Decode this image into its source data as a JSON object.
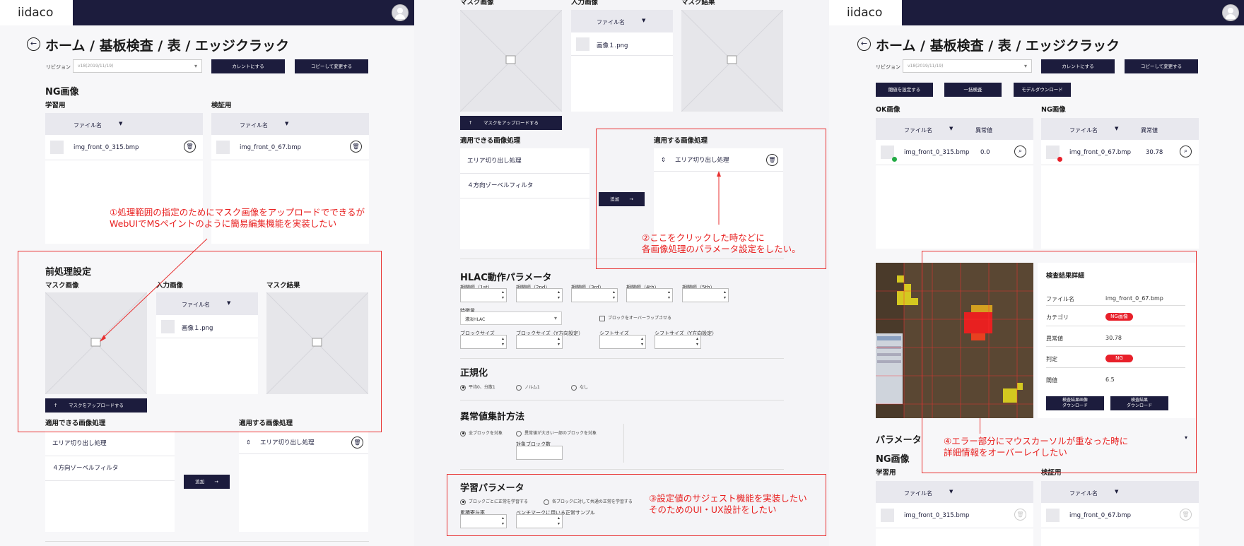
{
  "brand": {
    "name": "iidaco"
  },
  "breadcrumb": "ホーム / 基板検査 / 表 / エッジクラック",
  "revision": {
    "label": "リビジョン",
    "value": "v18(2019/11/19)"
  },
  "buttons": {
    "make_current": "カレントにする",
    "copy_change": "コピーして変更する",
    "set_threshold": "閾値を設定する",
    "batch_inspect": "一括検査",
    "model_download": "モデルダウンロード",
    "upload_mask": "マスクをアップロードする",
    "add": "追加",
    "download_results_images": "検査結果画像\nダウンロード",
    "download_results": "検査結果\nダウンロード"
  },
  "ng_images": {
    "title": "NG画像",
    "learning": "学習用",
    "validation": "検証用",
    "column_filename": "ファイル名",
    "learning_file": "img_front_0_315.bmp",
    "validation_file": "img_front_0_67.bmp"
  },
  "preprocess": {
    "title": "前処理設定",
    "mask_image": "マスク画像",
    "input_image": "入力画像",
    "mask_result": "マスク結果",
    "input_file": "画像１.png",
    "available_title": "適用できる画像処理",
    "applied_title": "適用する画像処理",
    "available": [
      "エリア切り出し処理",
      "４方向ゾーベルフィルタ"
    ],
    "applied": [
      "エリア切り出し処理"
    ]
  },
  "hlac": {
    "title": "HLAC動作パラメータ",
    "ranges": [
      "相関幅（1st）",
      "相関幅（2nd）",
      "相関幅（3rd）",
      "相関幅（4th）",
      "相関幅（5th）"
    ],
    "feature_label": "特徴量",
    "feature_value": "濃淡HLAC",
    "overlap": "ブロックをオーバーラップさせる",
    "block_size": "ブロックサイズ",
    "block_size_y": "ブロックサイズ（Y方向設定）",
    "shift_size": "シフトサイズ",
    "shift_size_y": "シフトサイズ（Y方向設定）"
  },
  "normalize": {
    "title": "正規化",
    "options": [
      "平均0、分散1",
      "ノルム1",
      "なし"
    ]
  },
  "anomaly": {
    "title": "異常値集計方法",
    "options": [
      "全ブロックを対象",
      "異常値が大きい一部のブロックを対象"
    ],
    "target_blocks": "対象ブロック数"
  },
  "learning_params": {
    "title": "学習パラメータ",
    "options": [
      "ブロックごとに正常を学習する",
      "各ブロックに対して共通の正常を学習する"
    ],
    "contribution": "累積寄与率",
    "benchmark": "ベンチマークに用いる正常サンプル"
  },
  "results": {
    "ok_title": "OK画像",
    "ng_title": "NG画像",
    "col_filename": "ファイル名",
    "col_anomaly": "異常値",
    "ok_file": "img_front_0_315.bmp",
    "ok_value": "0.0",
    "ng_file": "img_front_0_67.bmp",
    "ng_value": "30.78"
  },
  "detail": {
    "title": "検査結果詳細",
    "filename_label": "ファイル名",
    "filename": "img_front_0_67.bmp",
    "category_label": "カテゴリ",
    "category": "NG画像",
    "anomaly_label": "異常値",
    "anomaly": "30.78",
    "judge_label": "判定",
    "judge": "NG",
    "threshold_label": "閾値",
    "threshold": "6.5"
  },
  "params_title": "パラメータ",
  "notes": {
    "n1": "①処理範囲の指定のためにマスク画像をアップロードでできるが\nWebUIでMSペイントのように簡易編集機能を実装したい",
    "n2": "②ここをクリックした時などに\n各画像処理のパラメータ設定をしたい。",
    "n3": "③設定値のサジェスト機能を実装したい\nそのためのUI・UX設計をしたい",
    "n4": "④エラー部分にマウスカーソルが重なった時に\n詳細情報をオーバーレイしたい"
  },
  "colors": {
    "navy": "#1c1c3d",
    "accent": "#e83030",
    "ng": "#e8202a",
    "ok": "#22aa44"
  }
}
